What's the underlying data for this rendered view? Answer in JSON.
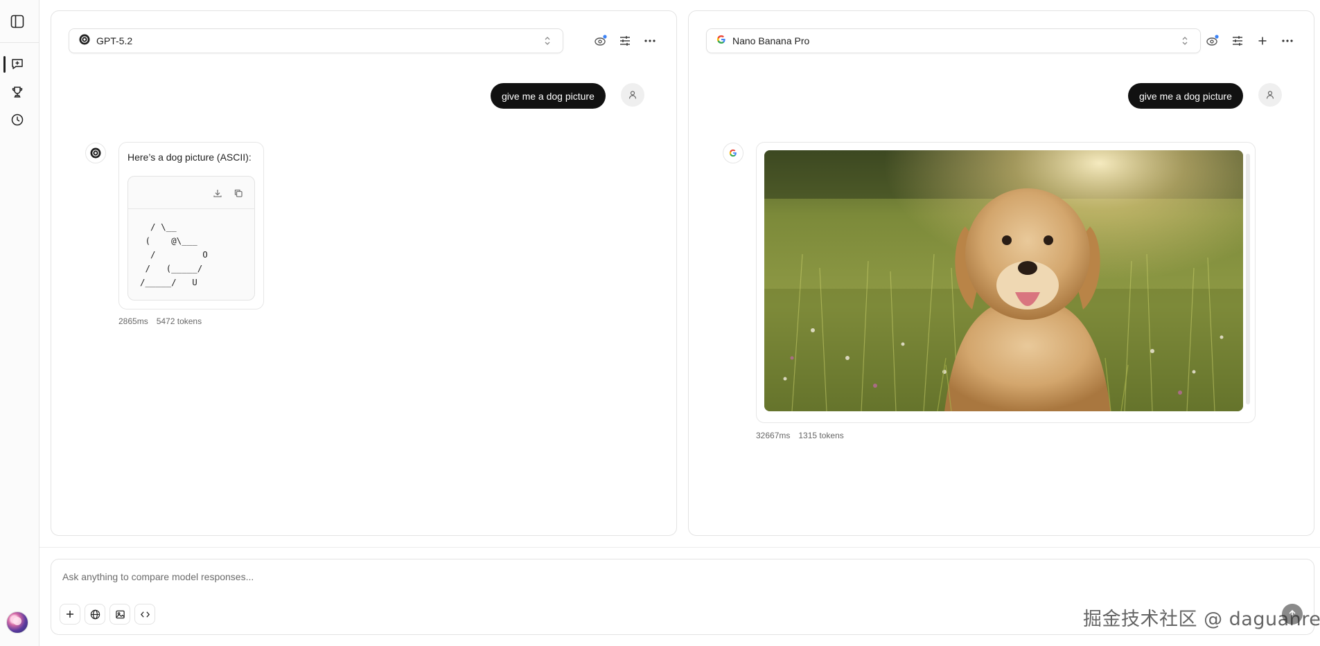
{
  "rail": {
    "icons": [
      "sidebar-toggle-icon",
      "chat-icon",
      "trophy-icon",
      "history-icon"
    ]
  },
  "left_panel": {
    "model_name": "GPT-5.2",
    "user_message": "give me a dog picture",
    "response_text": "Here’s a dog picture (ASCII):",
    "ascii_art": "  / \\__\n (    @\\___\n  /         O\n /   (_____/\n/_____/   U",
    "latency": "2865ms",
    "tokens": "5472 tokens"
  },
  "right_panel": {
    "model_name": "Nano Banana Pro",
    "user_message": "give me a dog picture",
    "latency": "32667ms",
    "tokens": "1315 tokens"
  },
  "composer": {
    "placeholder": "Ask anything to compare model responses..."
  },
  "watermark": "掘金技术社区 @ daguanren",
  "colors": {
    "user_bubble": "#111111",
    "border": "#e3e3e3",
    "accent_dot": "#3b82f6"
  }
}
